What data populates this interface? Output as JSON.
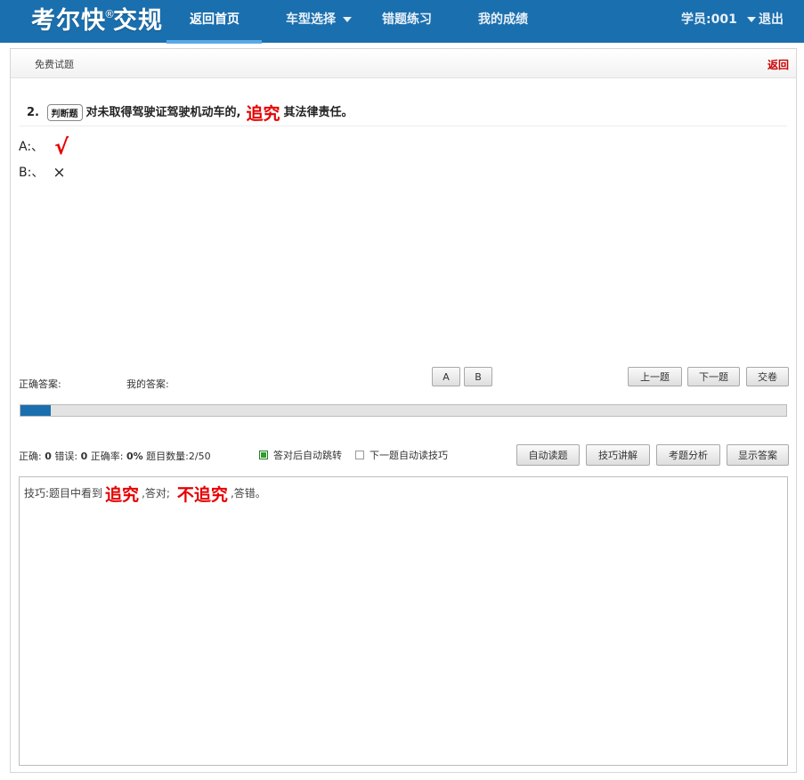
{
  "brand": {
    "part1": "考尔快",
    "reg": "®",
    "part2": "交规"
  },
  "nav": {
    "items": [
      {
        "label": "返回首页",
        "active": true
      },
      {
        "label": "车型选择",
        "dropdown": true
      },
      {
        "label": "错题练习"
      },
      {
        "label": "我的成绩"
      }
    ],
    "user": "学员:001",
    "logout": "退出"
  },
  "panel": {
    "title": "免费试题",
    "back": "返回"
  },
  "question": {
    "number": "2.",
    "type": "判断题",
    "text_before": "对未取得驾驶证驾驶机动车的,",
    "keyword": "追究",
    "text_after": "其法律责任。",
    "options": [
      {
        "prefix": "A:、",
        "mark": "√"
      },
      {
        "prefix": "B:、",
        "mark": "×"
      }
    ]
  },
  "answers": {
    "correct_label": "正确答案:",
    "mine_label": "我的答案:"
  },
  "answer_buttons": [
    "A",
    "B"
  ],
  "nav_buttons": {
    "prev": "上一题",
    "next": "下一题",
    "submit": "交卷"
  },
  "progress": {
    "current": 2,
    "total": 50,
    "fraction": 0.04
  },
  "stats": {
    "correct_label": "正确:",
    "correct": "0",
    "wrong_label": "错误:",
    "wrong": "0",
    "rate_label": "正确率:",
    "rate": "0%",
    "count": "题目数量:2/50"
  },
  "options": {
    "auto_jump": {
      "label": "答对后自动跳转",
      "checked": true
    },
    "auto_read_tip": {
      "label": "下一题自动读技巧",
      "checked": false
    }
  },
  "tool_buttons": [
    "自动读题",
    "技巧讲解",
    "考题分析",
    "显示答案"
  ],
  "tips": {
    "prefix": "技巧:题目中看到",
    "key1": "追究",
    "mid": ",答对;",
    "key2": "不追究",
    "suffix": ",答错。"
  },
  "colors": {
    "nav": "#1a6fae",
    "accent_red": "#e60000"
  }
}
